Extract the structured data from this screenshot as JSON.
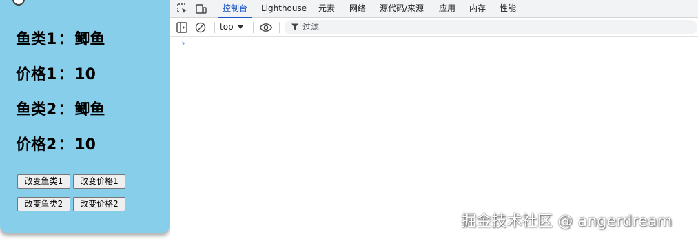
{
  "app": {
    "lines": [
      {
        "label": "鱼类1",
        "colon": "：",
        "value": "鲫鱼"
      },
      {
        "label": "价格1",
        "colon": "：",
        "value": "10"
      },
      {
        "label": "鱼类2",
        "colon": "：",
        "value": "鲫鱼"
      },
      {
        "label": "价格2",
        "colon": "：",
        "value": "10"
      }
    ],
    "buttons": {
      "change_fish1": "改变鱼类1",
      "change_price1": "改变价格1",
      "change_fish2": "改变鱼类2",
      "change_price2": "改变价格2"
    },
    "background_color": "#87ceeb"
  },
  "devtools": {
    "tabs": [
      {
        "label": "控制台",
        "active": true
      },
      {
        "label": "Lighthouse",
        "active": false
      },
      {
        "label": "元素",
        "active": false
      },
      {
        "label": "网络",
        "active": false
      },
      {
        "label": "源代码/来源",
        "active": false
      },
      {
        "label": "应用",
        "active": false
      },
      {
        "label": "内存",
        "active": false
      },
      {
        "label": "性能",
        "active": false
      }
    ],
    "toolbar": {
      "context": "top",
      "filter_placeholder": "过滤"
    },
    "console_prompt": "›",
    "accent_color": "#1a57c8"
  },
  "watermark": "掘金技术社区 @ angerdream"
}
